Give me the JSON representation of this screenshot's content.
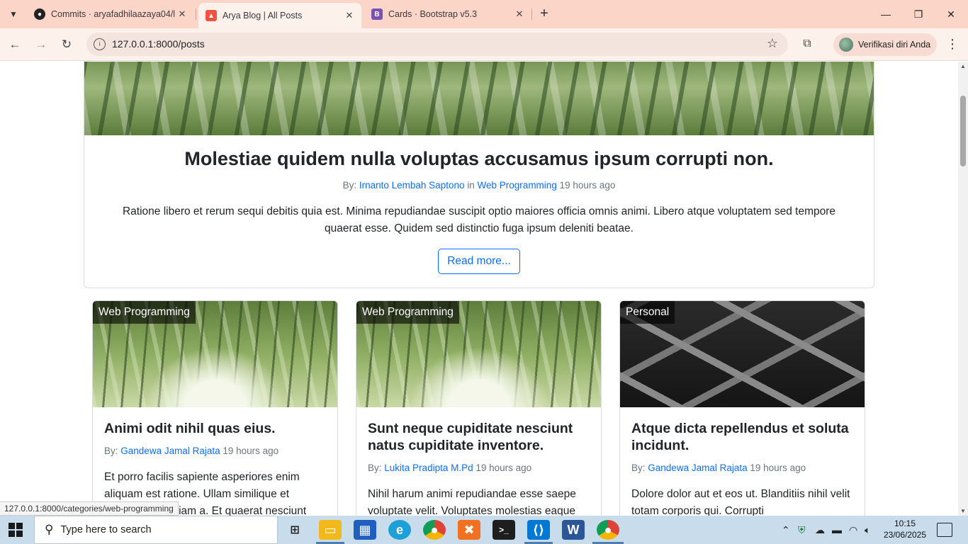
{
  "browser": {
    "tabs": [
      {
        "title": "Commits · aryafadhilaazaya04/l",
        "favicon": "github-icon",
        "active": false
      },
      {
        "title": "Arya Blog | All Posts",
        "favicon": "laravel-icon",
        "active": true
      },
      {
        "title": "Cards · Bootstrap v5.3",
        "favicon": "bootstrap-icon",
        "favicon_letter": "B",
        "active": false
      }
    ],
    "url": "127.0.0.1:8000/posts",
    "profile_label": "Verifikasi diri Anda",
    "status_url": "127.0.0.1:8000/categories/web-programming"
  },
  "hero": {
    "title": "Molestiae quidem nulla voluptas accusamus ipsum corrupti non.",
    "by_label": "By:",
    "author": "Irnanto Lembah Saptono",
    "in_label": "in",
    "category": "Web Programming",
    "time": "19 hours ago",
    "excerpt": "Ratione libero et rerum sequi debitis quia est. Minima repudiandae suscipit optio maiores officia omnis animi. Libero atque voluptatem sed tempore quaerat esse. Quidem sed distinctio fuga ipsum deleniti beatae.",
    "button": "Read more..."
  },
  "posts": [
    {
      "category": "Web Programming",
      "title": "Animi odit nihil quas eius.",
      "by_label": "By:",
      "author": "Gandewa Jamal Rajata",
      "time": "19 hours ago",
      "excerpt": "Et porro facilis sapiente asperiores enim aliquam est ratione. Ullam similique et voluptatum veniam a. Et quaerat nesciunt"
    },
    {
      "category": "Web Programming",
      "title": "Sunt neque cupiditate nesciunt natus cupiditate inventore.",
      "by_label": "By:",
      "author": "Lukita Pradipta M.Pd",
      "time": "19 hours ago",
      "excerpt": "Nihil harum animi repudiandae esse saepe voluptate velit. Voluptates molestias eaque"
    },
    {
      "category": "Personal",
      "title": "Atque dicta repellendus et soluta incidunt.",
      "by_label": "By:",
      "author": "Gandewa Jamal Rajata",
      "time": "19 hours ago",
      "excerpt": "Dolore dolor aut et eos ut. Blanditiis nihil velit totam corporis qui. Corrupti"
    }
  ],
  "taskbar": {
    "search_placeholder": "Type here to search",
    "time": "10:15",
    "date": "23/06/2025"
  },
  "colors": {
    "tabbar": "#fcd5c9",
    "link": "#0d6efd",
    "taskbar": "#c9dcec"
  }
}
